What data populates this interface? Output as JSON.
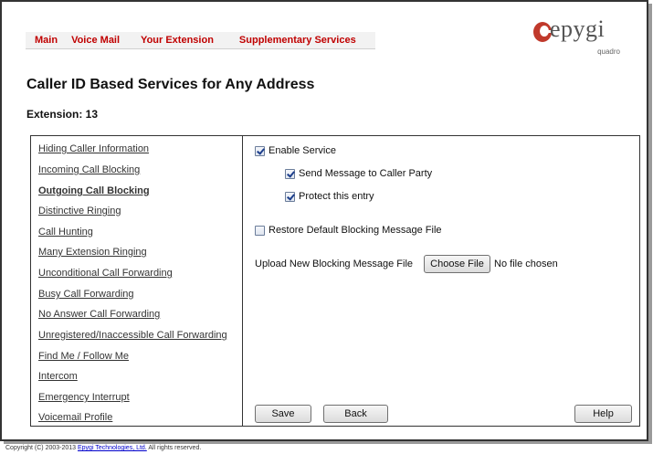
{
  "nav": {
    "items": [
      {
        "label": "Main"
      },
      {
        "label": "Voice Mail"
      },
      {
        "label": "Your Extension"
      },
      {
        "label": "Supplementary Services"
      }
    ]
  },
  "logo": {
    "text": "epygi",
    "sub": "quadro",
    "accent": "#c0392b"
  },
  "page": {
    "title": "Caller ID Based Services for Any Address",
    "extension": "Extension: 13"
  },
  "menu": {
    "items": [
      {
        "label": "Hiding Caller Information"
      },
      {
        "label": "Incoming Call Blocking"
      },
      {
        "label": "Outgoing Call Blocking",
        "active": true
      },
      {
        "label": "Distinctive Ringing"
      },
      {
        "label": "Call Hunting"
      },
      {
        "label": "Many Extension Ringing"
      },
      {
        "label": "Unconditional Call Forwarding"
      },
      {
        "label": "Busy Call Forwarding"
      },
      {
        "label": "No Answer Call Forwarding"
      },
      {
        "label": "Unregistered/Inaccessible Call Forwarding"
      },
      {
        "label": "Find Me / Follow Me"
      },
      {
        "label": "Intercom"
      },
      {
        "label": "Emergency Interrupt"
      },
      {
        "label": "Voicemail Profile"
      }
    ]
  },
  "form": {
    "enable_service": {
      "label": "Enable Service",
      "checked": true
    },
    "send_message": {
      "label": "Send Message to Caller Party",
      "checked": true
    },
    "protect_entry": {
      "label": "Protect this entry",
      "checked": true
    },
    "restore_default": {
      "label": "Restore Default Blocking Message File",
      "checked": false
    },
    "upload": {
      "label": "Upload New Blocking Message File",
      "button": "Choose File",
      "status": "No file chosen"
    }
  },
  "buttons": {
    "save": "Save",
    "back": "Back",
    "help": "Help"
  },
  "footer": {
    "prefix": "Copyright (C) 2003-2013 ",
    "link": "Epygi Technologies, Ltd.",
    "suffix": " All rights reserved."
  }
}
